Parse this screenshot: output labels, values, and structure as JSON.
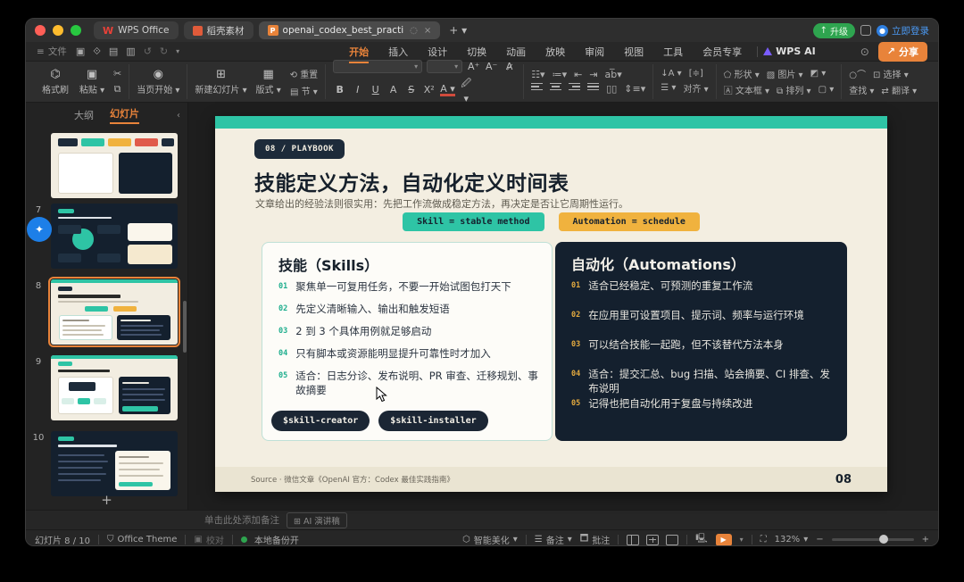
{
  "titlebar": {
    "tabs": [
      "WPS Office",
      "稻壳素材",
      "openai_codex_best_practi"
    ],
    "new_tab": "+",
    "upgrade": "升级",
    "login": "立即登录"
  },
  "menubar": {
    "file": "文件",
    "items": [
      "开始",
      "插入",
      "设计",
      "切换",
      "动画",
      "放映",
      "审阅",
      "视图",
      "工具",
      "会员专享"
    ],
    "active_item": "开始",
    "wps_ai": "WPS AI",
    "share": "分享"
  },
  "toolbar": {
    "format_painter": "格式刷",
    "paste": "粘贴",
    "start_from_page": "当页开始",
    "new_slide": "新建幻灯片",
    "layout": "版式",
    "reset": "重置",
    "section": "节",
    "format_buttons": [
      "B",
      "I",
      "U",
      "A",
      "S",
      "X²"
    ],
    "shapes": "形状",
    "picture": "图片",
    "textbox": "文本框",
    "arrange": "排列",
    "align": "对齐",
    "select": "选择",
    "find": "查找",
    "translate": "翻译"
  },
  "sidebar": {
    "tab_outline": "大纲",
    "tab_slides": "幻灯片",
    "slide_numbers": [
      "7",
      "8",
      "9",
      "10"
    ],
    "add_slide": "+"
  },
  "slide": {
    "badge": "08 / PLAYBOOK",
    "title": "技能定义方法，自动化定义时间表",
    "subtitle": "文章给出的经验法则很实用：先把工作流做成稳定方法，再决定是否让它周期性运行。",
    "pill_skill": "Skill = stable method",
    "pill_automation": "Automation = schedule",
    "skills": {
      "heading": "技能（Skills）",
      "items": [
        {
          "num": "01",
          "text": "聚焦单一可复用任务，不要一开始试图包打天下"
        },
        {
          "num": "02",
          "text": "先定义清晰输入、输出和触发短语"
        },
        {
          "num": "03",
          "text": "2 到 3 个具体用例就足够启动"
        },
        {
          "num": "04",
          "text": "只有脚本或资源能明显提升可靠性时才加入"
        },
        {
          "num": "05",
          "text": "适合：日志分诊、发布说明、PR 审查、迁移规划、事故摘要"
        }
      ],
      "tags": [
        "$skill-creator",
        "$skill-installer"
      ]
    },
    "automations": {
      "heading": "自动化（Automations）",
      "items": [
        {
          "num": "01",
          "text": "适合已经稳定、可预测的重复工作流"
        },
        {
          "num": "02",
          "text": "在应用里可设置项目、提示词、频率与运行环境"
        },
        {
          "num": "03",
          "text": "可以结合技能一起跑，但不该替代方法本身"
        },
        {
          "num": "04",
          "text": "适合：提交汇总、bug 扫描、站会摘要、CI 排查、发布说明"
        },
        {
          "num": "05",
          "text": "记得也把自动化用于复盘与持续改进"
        }
      ]
    },
    "source": "Source · 微信文章《OpenAI 官方：Codex 最佳实践指南》",
    "page_number": "08"
  },
  "notes": {
    "placeholder": "单击此处添加备注",
    "ai_button": "AI 演讲稿"
  },
  "statusbar": {
    "slide_counter": "幻灯片 8 / 10",
    "theme": "Office Theme",
    "proofread": "校对",
    "backup": "本地备份开",
    "beautify": "智能美化",
    "notes": "备注",
    "comments": "批注",
    "zoom_level": "132%"
  },
  "colors": {
    "accent_orange": "#e8833a",
    "teal": "#2ec4a5",
    "yellow": "#f0b23e",
    "dark_navy": "#14202e",
    "cream": "#f3eee1"
  }
}
